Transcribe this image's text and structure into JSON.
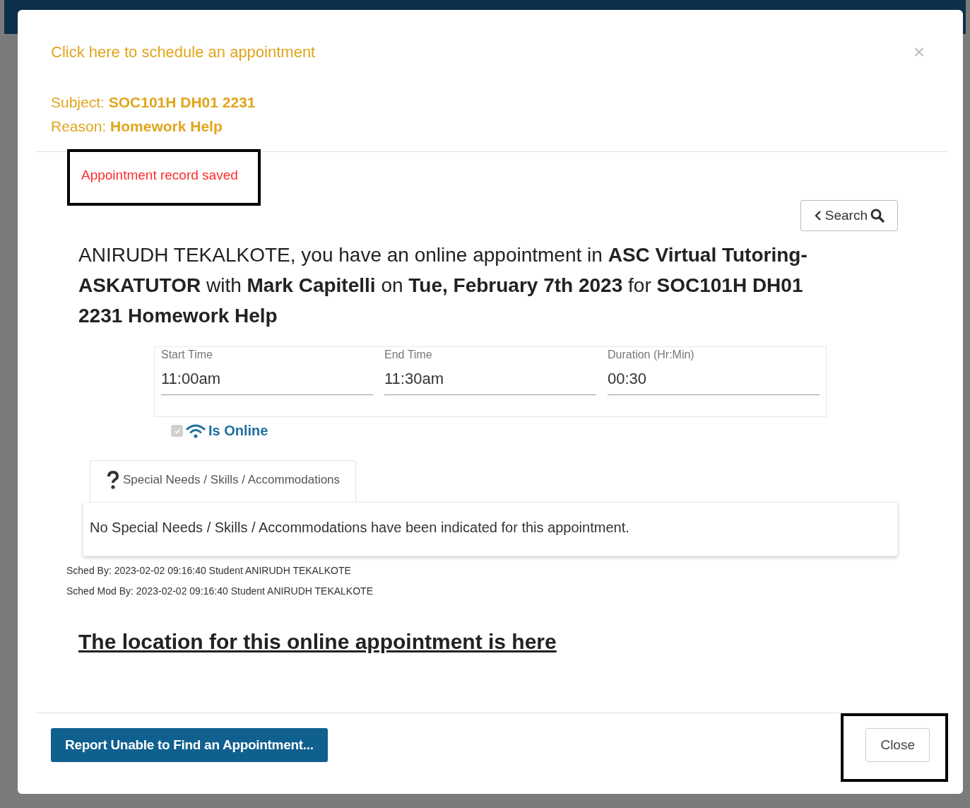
{
  "modal": {
    "schedule_link": "Click here to schedule an appointment",
    "close_icon": "×",
    "subject_label": "Subject:",
    "subject": "SOC101H DH01 2231",
    "reason_label": "Reason:",
    "reason": "Homework Help",
    "message": "Appointment record saved",
    "message_highlighted": true,
    "search_button": "Search",
    "summary": "ANIRUDH TEKALKOTE, you have an online appointment in **ASC Virtual Tutoring-ASKATUTOR** with **Mark Capitelli** on **Tue, February 7th 2023** for **SOC101H DH01 2231 Homework Help**",
    "times": [
      {
        "label": "Start Time",
        "value": "11:00am"
      },
      {
        "label": "End Time",
        "value": "11:30am"
      },
      {
        "label": "Duration (Hr:Min)",
        "value": "00:30"
      }
    ],
    "is_online": {
      "label": "Is Online",
      "checked": true,
      "disabled": true
    },
    "tabs": [
      {
        "label": "Special Needs / Skills / Accommodations",
        "selected": true
      }
    ],
    "tab_content": "No Special Needs / Skills / Accommodations have been indicated for this appointment.",
    "audit": [
      "Sched By: 2023-02-02 09:16:40 Student ANIRUDH TEKALKOTE",
      "Sched Mod By: 2023-02-02 09:16:40 Student ANIRUDH TEKALKOTE"
    ],
    "location_link": "The location for this online appointment is here",
    "footer": {
      "report_button": "Report Unable to Find an Appointment...",
      "close_button": "Close",
      "close_highlighted": true
    }
  }
}
